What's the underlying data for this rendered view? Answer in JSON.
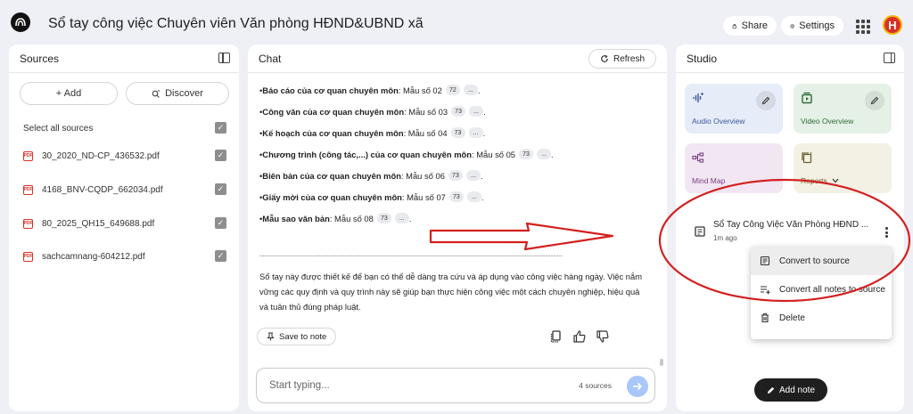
{
  "header": {
    "title": "Sổ tay công việc Chuyên viên Văn phòng HĐND&UBND xã",
    "share_label": "Share",
    "settings_label": "Settings",
    "avatar_letter": "H"
  },
  "sources": {
    "title": "Sources",
    "add_label": "+ Add",
    "discover_label": "Discover",
    "select_all_label": "Select all sources",
    "items": [
      {
        "name": "30_2020_ND-CP_436532.pdf"
      },
      {
        "name": "4168_BNV-CQDP_662034.pdf"
      },
      {
        "name": "80_2025_QH15_649688.pdf"
      },
      {
        "name": "sachcamnang-604212.pdf"
      }
    ],
    "pdf_badge": "PDF"
  },
  "chat": {
    "title": "Chat",
    "refresh_label": "Refresh",
    "bullets": [
      {
        "bold": "Báo cáo của cơ quan chuyên môn",
        "rest": ": Mẫu số 02",
        "chip": "72"
      },
      {
        "bold": "Công văn của cơ quan chuyên môn",
        "rest": ": Mẫu số 03",
        "chip": "73"
      },
      {
        "bold": "Kế hoạch của cơ quan chuyên môn",
        "rest": ": Mẫu số 04",
        "chip": "73"
      },
      {
        "bold": "Chương trình (công tác,...) của cơ quan chuyên môn",
        "rest": ": Mẫu số 05",
        "chip": "73"
      },
      {
        "bold": "Biên bản của cơ quan chuyên môn",
        "rest": ": Mẫu số 06",
        "chip": "73"
      },
      {
        "bold": "Giấy mời của cơ quan chuyên môn",
        "rest": ": Mẫu số 07",
        "chip": "73"
      },
      {
        "bold": "Mẫu sao văn bản",
        "rest": ": Mẫu số 08",
        "chip": "73"
      }
    ],
    "more_chip": "...",
    "divider": "------------------------------------------------------------------------------------------------------------------",
    "paragraph": "Sổ tay này được thiết kế để bạn có thể dễ dàng tra cứu và áp dụng vào công việc hàng ngày. Việc nắm vững các quy định và quy trình này sẽ giúp bạn thực hiện công việc một cách chuyên nghiệp, hiệu quả và tuân thủ đúng pháp luật.",
    "save_note_label": "Save to note",
    "input_placeholder": "Start typing...",
    "sources_count": "4 sources"
  },
  "studio": {
    "title": "Studio",
    "tiles": {
      "audio": {
        "label": "Audio Overview",
        "bg": "#e6ecf8",
        "color": "#3b5a9a"
      },
      "video": {
        "label": "Video Overview",
        "bg": "#e5f1e6",
        "color": "#2f6b3a"
      },
      "mindmap": {
        "label": "Mind Map",
        "bg": "#f1e6f2",
        "color": "#7a3f85"
      },
      "reports": {
        "label": "Reports",
        "bg": "#f3f1e3",
        "color": "#6b6331"
      }
    },
    "note": {
      "title": "Sổ Tay Công Việc Văn Phòng HĐND ...",
      "time": "1m ago"
    },
    "menu": {
      "convert_label": "Convert to source",
      "convert_all_label": "Convert all notes to source",
      "delete_label": "Delete"
    },
    "add_note_label": "Add note"
  },
  "annotation_color": "#d32020"
}
